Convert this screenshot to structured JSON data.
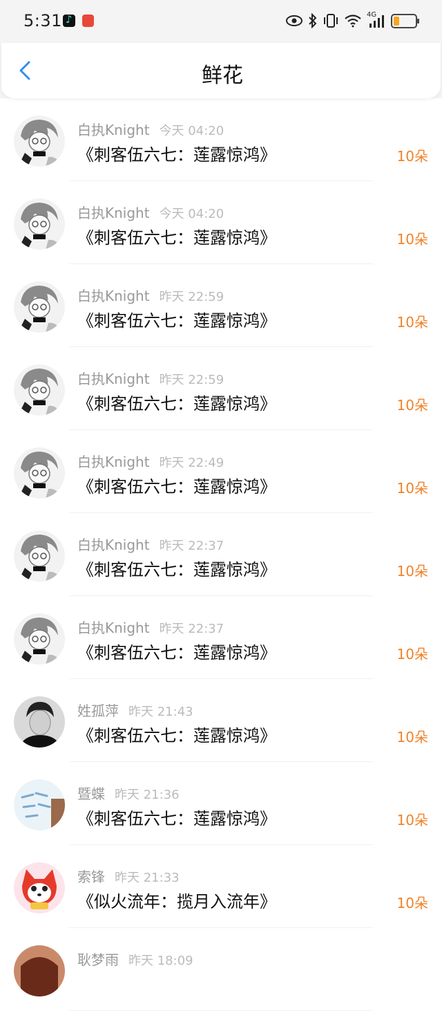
{
  "status": {
    "time": "5:31",
    "network": "4G"
  },
  "header": {
    "title": "鲜花"
  },
  "items": [
    {
      "user": "白执Knight",
      "time": "今天 04:20",
      "book": "《刺客伍六七：莲露惊鸿》",
      "quantity": "10朵",
      "avatar": "anime-girl"
    },
    {
      "user": "白执Knight",
      "time": "今天 04:20",
      "book": "《刺客伍六七：莲露惊鸿》",
      "quantity": "10朵",
      "avatar": "anime-girl"
    },
    {
      "user": "白执Knight",
      "time": "昨天 22:59",
      "book": "《刺客伍六七：莲露惊鸿》",
      "quantity": "10朵",
      "avatar": "anime-girl"
    },
    {
      "user": "白执Knight",
      "time": "昨天 22:59",
      "book": "《刺客伍六七：莲露惊鸿》",
      "quantity": "10朵",
      "avatar": "anime-girl"
    },
    {
      "user": "白执Knight",
      "time": "昨天 22:49",
      "book": "《刺客伍六七：莲露惊鸿》",
      "quantity": "10朵",
      "avatar": "anime-girl"
    },
    {
      "user": "白执Knight",
      "time": "昨天 22:37",
      "book": "《刺客伍六七：莲露惊鸿》",
      "quantity": "10朵",
      "avatar": "anime-girl"
    },
    {
      "user": "白执Knight",
      "time": "昨天 22:37",
      "book": "《刺客伍六七：莲露惊鸿》",
      "quantity": "10朵",
      "avatar": "anime-girl"
    },
    {
      "user": "姓孤萍",
      "time": "昨天 21:43",
      "book": "《刺客伍六七：莲露惊鸿》",
      "quantity": "10朵",
      "avatar": "man-photo"
    },
    {
      "user": "暨蝶",
      "time": "昨天 21:36",
      "book": "《刺客伍六七：莲露惊鸿》",
      "quantity": "10朵",
      "avatar": "handwriting"
    },
    {
      "user": "索锋",
      "time": "昨天 21:33",
      "book": "《似火流年：揽月入流年》",
      "quantity": "10朵",
      "avatar": "cartoon-fox"
    },
    {
      "user": "耿梦雨",
      "time": "昨天 18:09",
      "book": "",
      "quantity": "",
      "avatar": "photo"
    }
  ]
}
